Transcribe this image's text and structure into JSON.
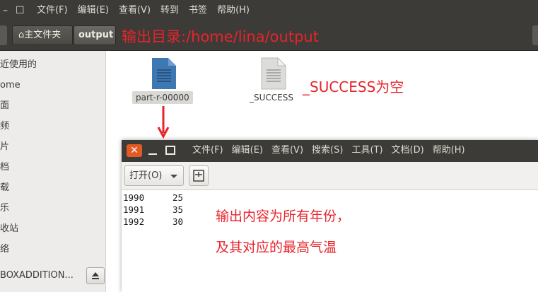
{
  "file_manager": {
    "menu": [
      "文件(F)",
      "编辑(E)",
      "查看(V)",
      "转到",
      "书签",
      "帮助(H)"
    ],
    "breadcrumb": {
      "home_label": "主文件夹",
      "current_label": "output"
    },
    "sidebar": {
      "items": [
        "近使用的",
        "ome",
        "面",
        "频",
        "片",
        "档",
        "载",
        "乐",
        "收站",
        "络"
      ],
      "device_label": "BOXADDITION..."
    },
    "files": [
      {
        "name": "part-r-00000",
        "icon": "text-document-icon",
        "color": "#3e78b2"
      },
      {
        "name": "_SUCCESS",
        "icon": "blank-document-icon",
        "color": "#d8d8d6"
      }
    ]
  },
  "annotations": {
    "output_dir": "输出目录:/home/lina/output",
    "success_note": "_SUCCESS为空",
    "content_note_line1": "输出内容为所有年份，",
    "content_note_line2": "及其对应的最高气温",
    "color": "#e8232b"
  },
  "editor": {
    "menu": [
      "文件(F)",
      "编辑(E)",
      "查看(V)",
      "搜索(S)",
      "工具(T)",
      "文档(D)",
      "帮助(H)"
    ],
    "open_label": "打开(O)",
    "rows": [
      {
        "year": "1990",
        "temp": "25"
      },
      {
        "year": "1991",
        "temp": "35"
      },
      {
        "year": "1992",
        "temp": "30"
      }
    ]
  }
}
